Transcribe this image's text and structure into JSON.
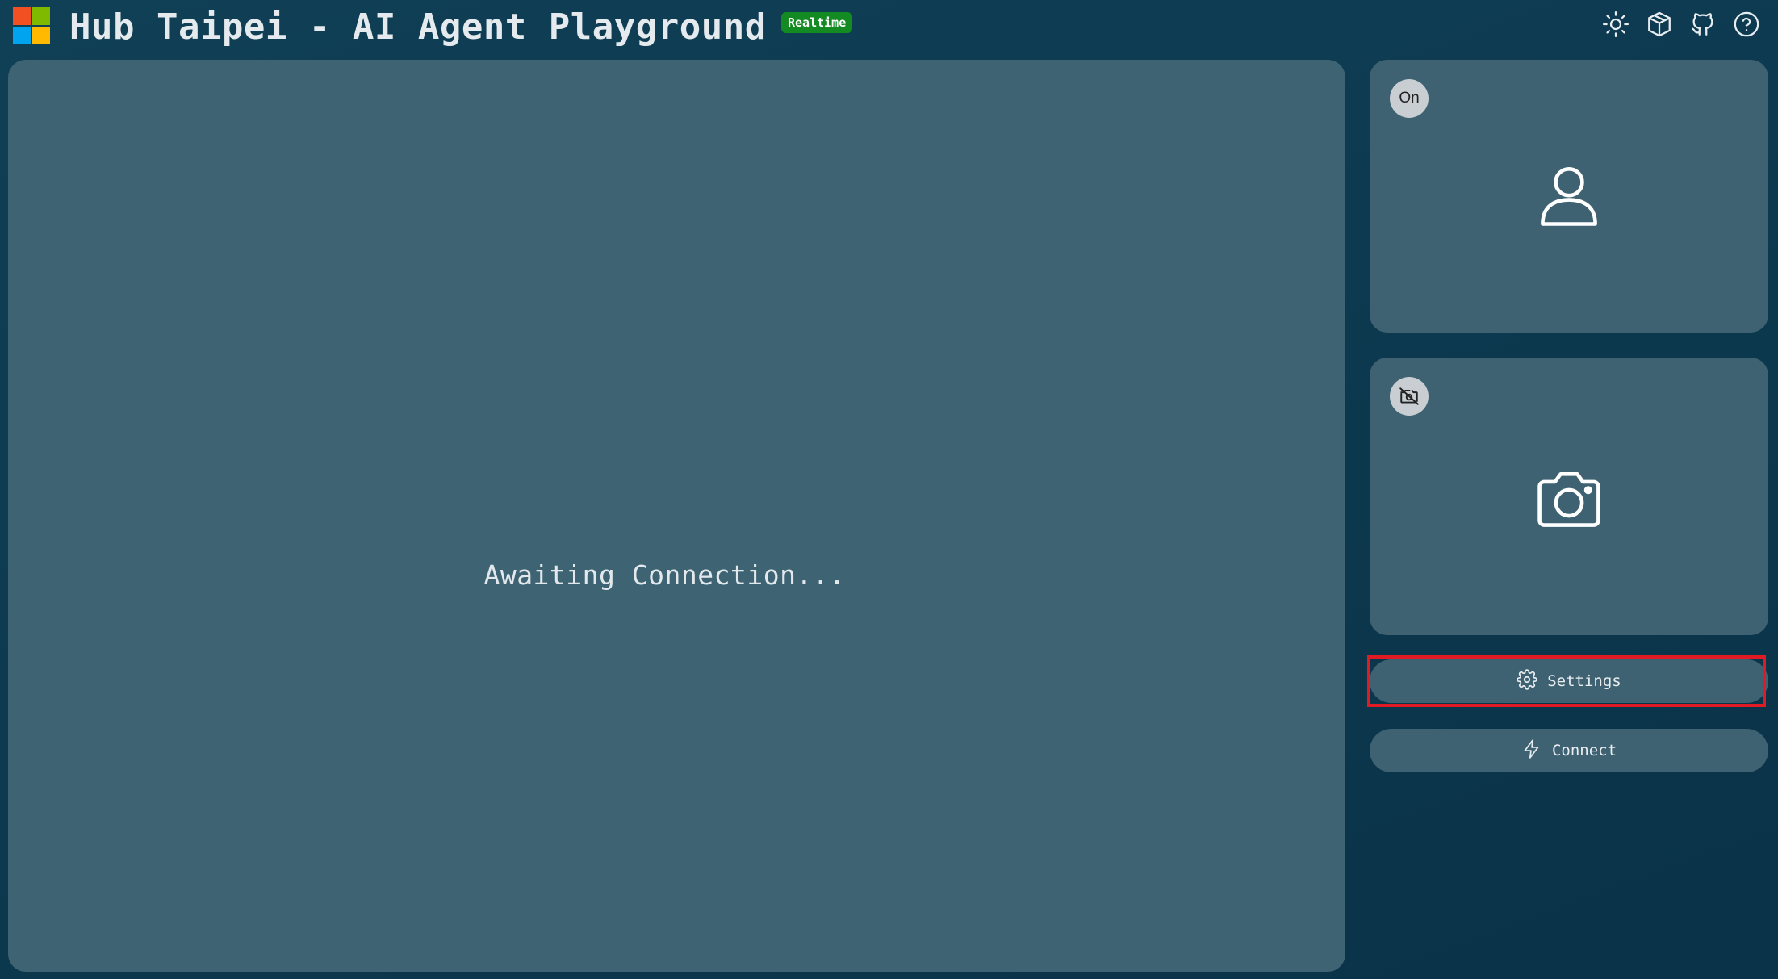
{
  "header": {
    "title": "Hub Taipei - AI Agent Playground",
    "badge": "Realtime",
    "logo_colors": [
      "#f25022",
      "#7fba00",
      "#00a4ef",
      "#ffb900"
    ],
    "icons": [
      "sun-icon",
      "cube-icon",
      "github-icon",
      "help-icon"
    ]
  },
  "main": {
    "status": "Awaiting Connection..."
  },
  "side": {
    "user_card": {
      "toggle_label": "On",
      "icon": "user-icon"
    },
    "camera_card": {
      "toggle_icon": "camera-off-icon",
      "icon": "camera-icon"
    },
    "settings_label": "Settings",
    "connect_label": "Connect"
  },
  "colors": {
    "background": "#0d3a50",
    "panel": "#3e6373",
    "badge": "#138a22",
    "highlight": "#e01b24"
  }
}
